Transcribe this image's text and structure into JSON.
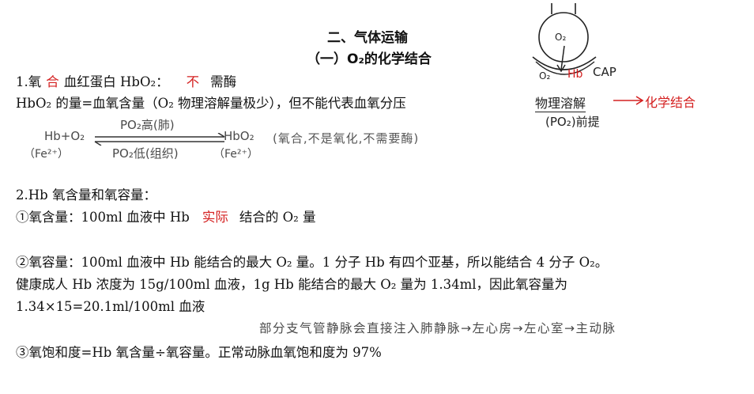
{
  "heading": {
    "main": "二、气体运输",
    "sub": "（一）O₂的化学结合"
  },
  "item1": {
    "prefix": "1.氧",
    "red1": "合",
    "mid": "血红蛋白 HbO₂：",
    "red2": "不",
    "suffix": "需酶",
    "line2": "HbO₂ 的量=血氧含量（O₂ 物理溶解量极少），但不能代表血氧分压"
  },
  "equation": {
    "left": "Hb+O₂",
    "left_sub": "（Fe²⁺）",
    "top_label": "PO₂高(肺)",
    "bottom_label": "PO₂低(组织)",
    "right": "HbO₂",
    "right_sub": "（Fe²⁺）",
    "note": "(氧合,不是氧化,不需要酶)"
  },
  "diagram": {
    "o2_in_circle": "O₂",
    "o2_label": "O₂",
    "hb_label": "Hb",
    "cap_label": "CAP",
    "physical": "物理溶解",
    "chemical": "化学结合",
    "premise": "(PO₂)前提"
  },
  "item2": {
    "title": "2.Hb 氧含量和氧容量：",
    "content_prefix": "①氧含量：100ml 血液中 Hb",
    "content_red": "实际",
    "content_suffix": "结合的 O₂ 量",
    "capacity_line1": "②氧容量：100ml 血液中 Hb 能结合的最大 O₂ 量。1 分子 Hb 有四个亚基，所以能结合 4 分子 O₂。",
    "capacity_line2": "健康成人 Hb 浓度为 15g/100ml 血液，1g Hb 能结合的最大 O₂ 量为 1.34ml，因此氧容量为",
    "capacity_line3": "1.34×15=20.1ml/100ml 血液",
    "handnote": "部分支气管静脉会直接注入肺静脉→左心房→左心室→主动脉",
    "saturation": "③氧饱和度=Hb 氧含量÷氧容量。正常动脉血氧饱和度为 97%"
  },
  "colors": {
    "red": "#d42020",
    "text": "#111111",
    "handwriting": "#4a4a4a"
  }
}
